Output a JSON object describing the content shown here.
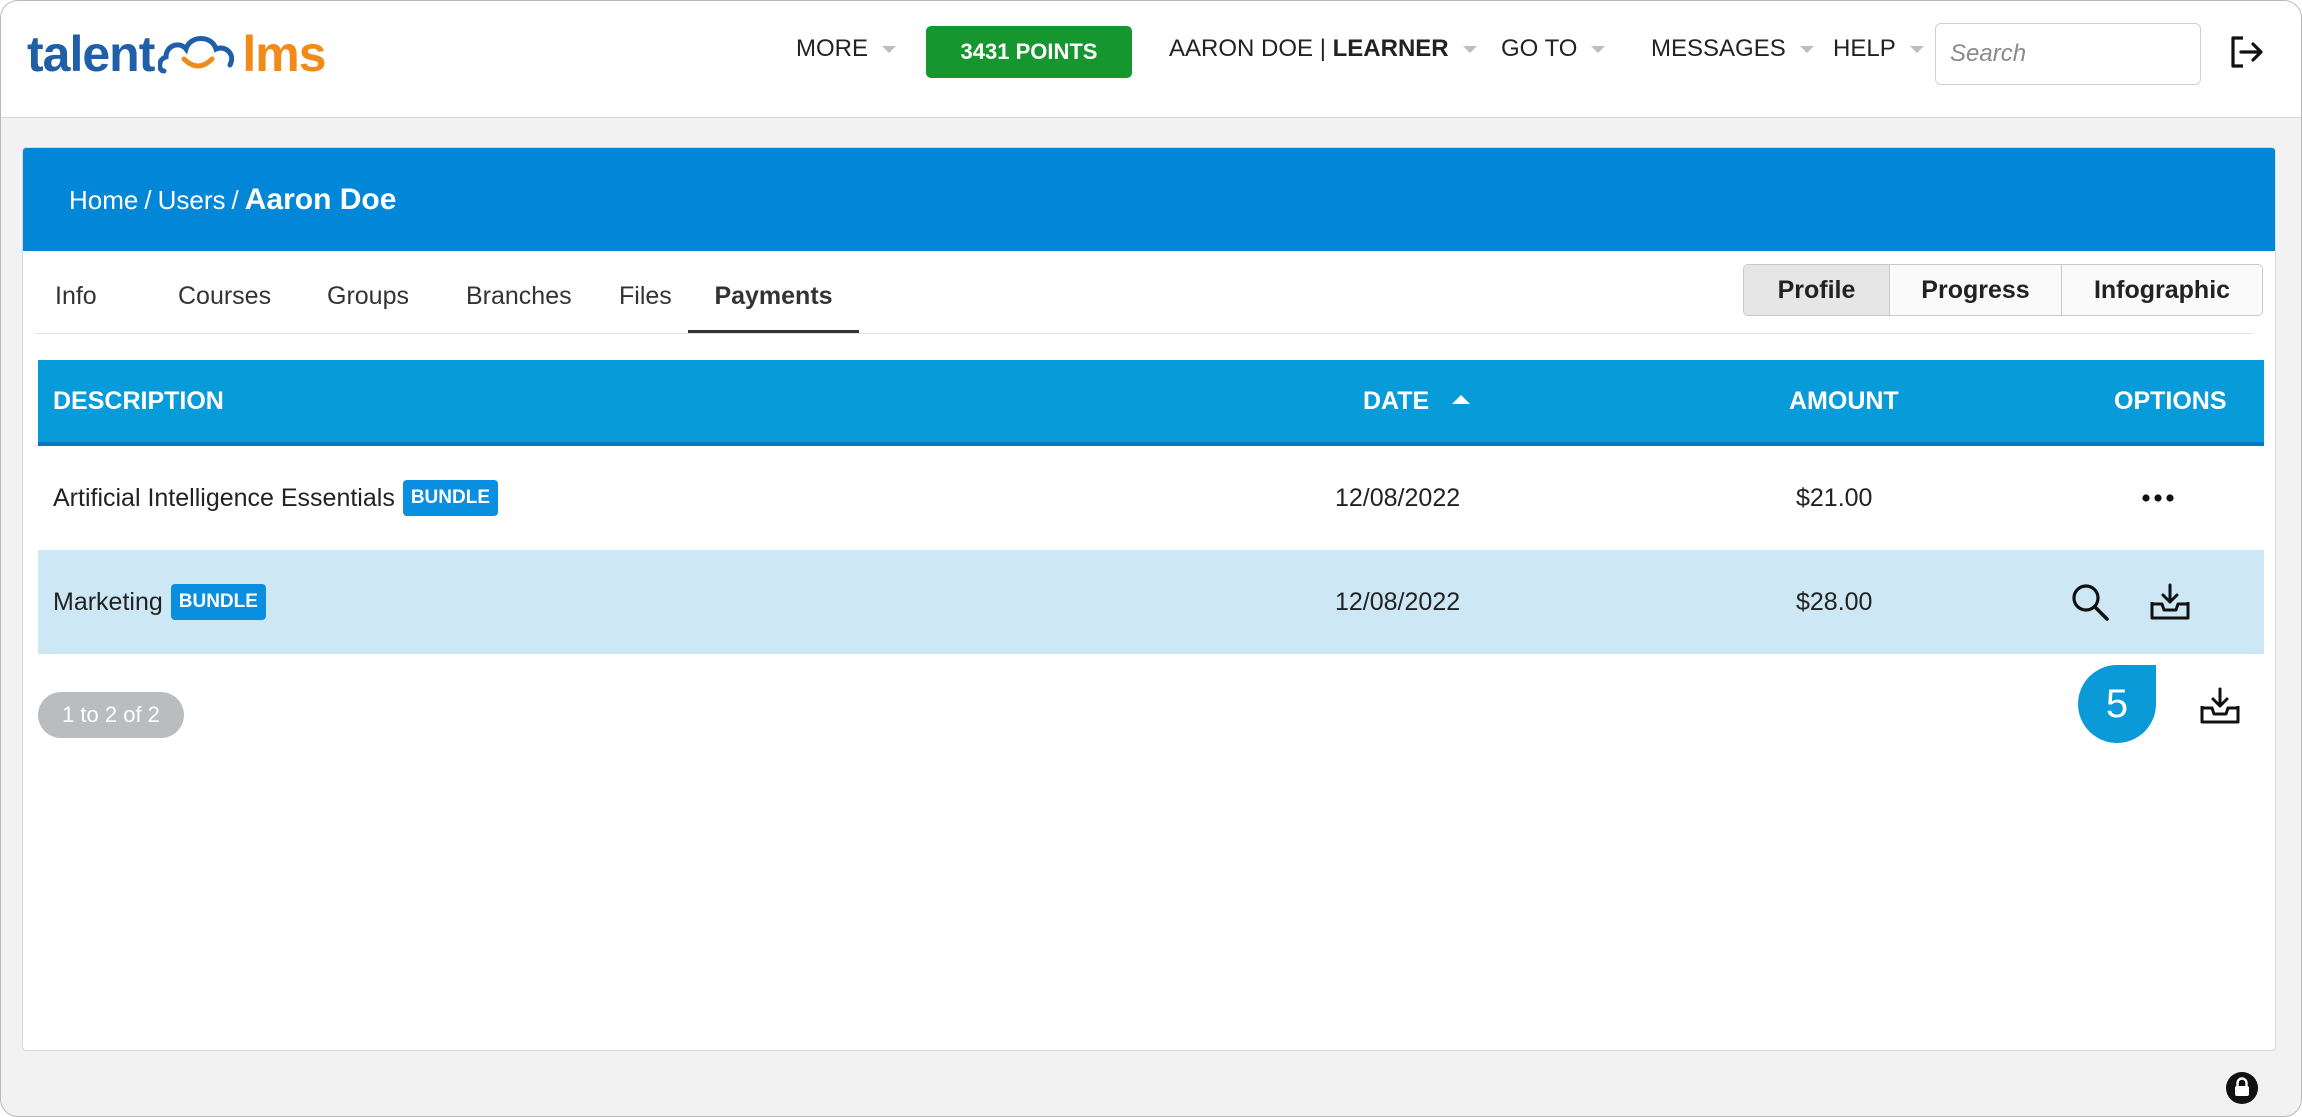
{
  "app": {
    "logo_left": "talent",
    "logo_right": "lms"
  },
  "topnav": {
    "more": "MORE",
    "points": "3431 POINTS",
    "user_name": "AARON DOE",
    "user_sep": " | ",
    "user_role": "LEARNER",
    "goto": "GO TO",
    "messages": "MESSAGES",
    "help": "HELP",
    "search_placeholder": "Search"
  },
  "breadcrumb": {
    "home": "Home",
    "users": "Users",
    "sep": "/",
    "current": "Aaron Doe"
  },
  "tabs": [
    "Info",
    "Courses",
    "Groups",
    "Branches",
    "Files",
    "Payments"
  ],
  "active_tab": "Payments",
  "view_buttons": [
    "Profile",
    "Progress",
    "Infographic"
  ],
  "active_view": "Profile",
  "table": {
    "headers": {
      "description": "DESCRIPTION",
      "date": "DATE",
      "amount": "AMOUNT",
      "options": "OPTIONS"
    },
    "rows": [
      {
        "description": "Artificial Intelligence Essentials",
        "badge": "BUNDLE",
        "date": "12/08/2022",
        "amount": "$21.00"
      },
      {
        "description": "Marketing",
        "badge": "BUNDLE",
        "date": "12/08/2022",
        "amount": "$28.00"
      }
    ]
  },
  "pager": "1 to 2 of 2",
  "callout": "5",
  "colors": {
    "brand_blue": "#0287d8",
    "header_blue": "#089bd9",
    "points_green": "#16962e",
    "row_highlight": "#cde8f4"
  }
}
